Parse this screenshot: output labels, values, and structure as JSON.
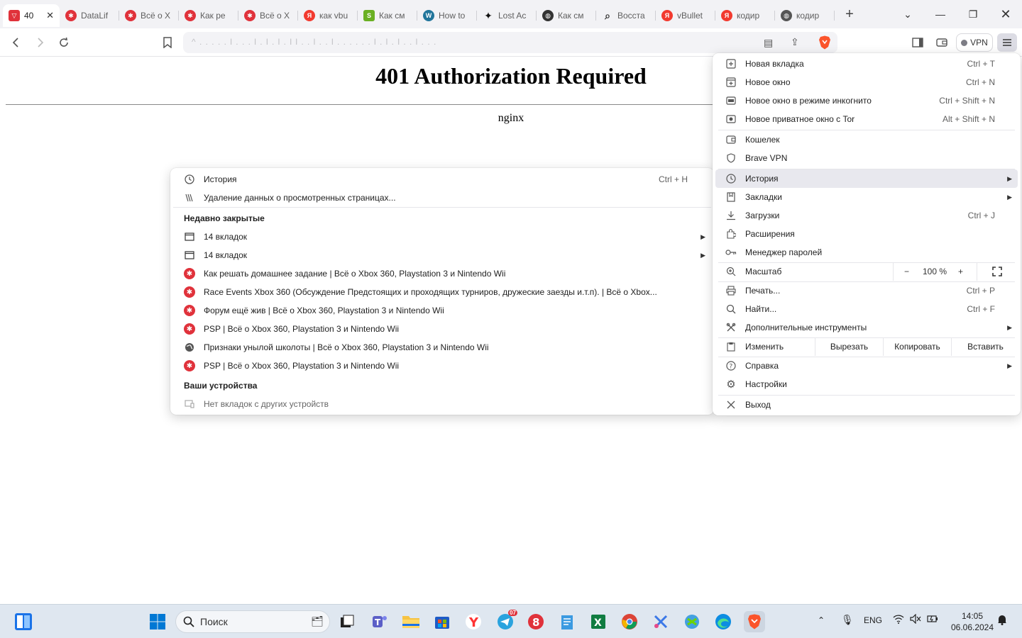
{
  "tabs": [
    {
      "title": "40",
      "fav": "brave",
      "color": "#e0323b",
      "active": true
    },
    {
      "title": "DataLif",
      "fav": "x-ball",
      "color": "#e0323b"
    },
    {
      "title": "Всё о X",
      "fav": "x-ball",
      "color": "#e0323b"
    },
    {
      "title": "Как ре",
      "fav": "x-ball",
      "color": "#e0323b"
    },
    {
      "title": "Всё о X",
      "fav": "x-ball",
      "color": "#e0323b"
    },
    {
      "title": "как vbu",
      "fav": "yandex",
      "color": "#f23a2f"
    },
    {
      "title": "Как см",
      "fav": "s-green",
      "color": "#6ab023"
    },
    {
      "title": "How to",
      "fav": "wordpress",
      "color": "#21759b"
    },
    {
      "title": "Lost Ac",
      "fav": "compass",
      "color": "#111111"
    },
    {
      "title": "Как см",
      "fav": "globe-dark",
      "color": "#333333"
    },
    {
      "title": "Восста",
      "fav": "search",
      "color": "#333333"
    },
    {
      "title": "vBullet",
      "fav": "yandex",
      "color": "#f23a2f"
    },
    {
      "title": "кодир",
      "fav": "yandex",
      "color": "#f23a2f"
    },
    {
      "title": "кодир",
      "fav": "globe",
      "color": "#555555"
    }
  ],
  "toolbar": {
    "url_placeholder": "^ . . . . . l . . . l . l . l . l l . . l . . l . . . . . . l . l . l . . l . . .",
    "vpn_label": "VPN"
  },
  "page": {
    "title": "401 Authorization Required",
    "server": "nginx"
  },
  "history_menu": {
    "history": {
      "label": "История",
      "shortcut": "Ctrl + H"
    },
    "clear": {
      "label": "Удаление данных о просмотренных страницах..."
    },
    "recent_heading": "Недавно закрытые",
    "recent": [
      {
        "label": "14 вкладок",
        "icon": "window",
        "submenu": true
      },
      {
        "label": "14 вкладок",
        "icon": "window",
        "submenu": true
      },
      {
        "label": "Как решать домашнее задание | Всё о Xbox 360, Playstation 3 и Nintendo Wii",
        "icon": "x-ball"
      },
      {
        "label": "Race Events Xbox 360 (Обсуждение Предстоящих и проходящих турниров, дружеские заезды и.т.п). | Всё о Xbox...",
        "icon": "x-ball"
      },
      {
        "label": "Форум ещё жив | Всё о Xbox 360, Playstation 3 и Nintendo Wii",
        "icon": "x-ball"
      },
      {
        "label": "PSP | Всё о Xbox 360, Playstation 3 и Nintendo Wii",
        "icon": "x-ball"
      },
      {
        "label": "Признаки унылой школоты | Всё о Xbox 360, Playstation 3 и Nintendo Wii",
        "icon": "globe"
      },
      {
        "label": "PSP | Всё о Xbox 360, Playstation 3 и Nintendo Wii",
        "icon": "x-ball"
      }
    ],
    "devices_heading": "Ваши устройства",
    "no_devices": "Нет вкладок с других устройств"
  },
  "main_menu": {
    "new_tab": {
      "label": "Новая вкладка",
      "shortcut": "Ctrl + T"
    },
    "new_window": {
      "label": "Новое окно",
      "shortcut": "Ctrl + N"
    },
    "incognito": {
      "label": "Новое окно в режиме инкогнито",
      "shortcut": "Ctrl + Shift + N"
    },
    "tor": {
      "label": "Новое приватное окно с Tor",
      "shortcut": "Alt + Shift + N"
    },
    "wallet": {
      "label": "Кошелек"
    },
    "vpn": {
      "label": "Brave VPN"
    },
    "history": {
      "label": "История"
    },
    "bookmarks": {
      "label": "Закладки"
    },
    "downloads": {
      "label": "Загрузки",
      "shortcut": "Ctrl + J"
    },
    "extensions": {
      "label": "Расширения"
    },
    "passwords": {
      "label": "Менеджер паролей"
    },
    "zoom": {
      "label": "Масштаб",
      "minus": "−",
      "value": "100 %",
      "plus": "+"
    },
    "print": {
      "label": "Печать...",
      "shortcut": "Ctrl + P"
    },
    "find": {
      "label": "Найти...",
      "shortcut": "Ctrl + F"
    },
    "more_tools": {
      "label": "Дополнительные инструменты"
    },
    "edit": {
      "label": "Изменить",
      "cut": "Вырезать",
      "copy": "Копировать",
      "paste": "Вставить"
    },
    "help": {
      "label": "Справка"
    },
    "settings": {
      "label": "Настройки"
    },
    "exit": {
      "label": "Выход"
    }
  },
  "taskbar": {
    "search_placeholder": "Поиск",
    "lang": "ENG",
    "time": "14:05",
    "date": "06.06.2024",
    "telegram_badge": "07"
  }
}
